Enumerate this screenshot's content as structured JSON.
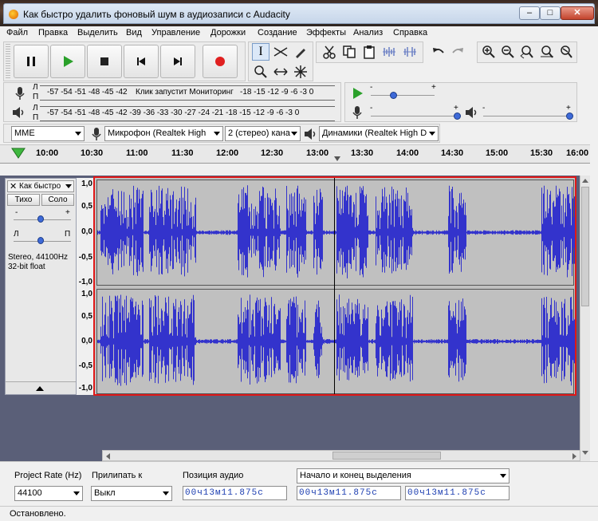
{
  "window": {
    "title": "Как быстро удалить фоновый шум в аудиозаписи с Audacity"
  },
  "menu": [
    "Файл",
    "Правка",
    "Выделить",
    "Вид",
    "Управление",
    "Дорожки",
    "Создание",
    "Эффекты",
    "Анализ",
    "Справка"
  ],
  "meters": {
    "record_channel_letters": [
      "Л",
      "П"
    ],
    "record_scale": "-57 -54 -51 -48 -45 -42",
    "record_prompt": "Клик запустит Мониторинг",
    "record_scale_tail": "-18 -15 -12 -9 -6 -3 0",
    "play_channel_letters": [
      "Л",
      "П"
    ],
    "play_scale": "-57 -54 -51 -48 -45 -42 -39 -36 -33 -30 -27 -24 -21 -18 -15 -12 -9 -6 -3 0"
  },
  "mixer": {
    "minus": "-",
    "plus": "+",
    "playback_volume": 0.3,
    "record_volume": 1.0,
    "playback_output_volume": 1.0
  },
  "device": {
    "host": "MME",
    "input": "Микрофон (Realtek High",
    "channels": "2 (стерео) кана",
    "output": "Динамики (Realtek High D"
  },
  "timeline": {
    "ticks": [
      "10:00",
      "10:30",
      "11:00",
      "11:30",
      "12:00",
      "12:30",
      "13:00",
      "13:30",
      "14:00",
      "14:30",
      "15:00",
      "15:30",
      "16:00"
    ]
  },
  "track": {
    "name": "Как быстро",
    "mute": "Тихо",
    "solo": "Соло",
    "gain_minus": "-",
    "gain_plus": "+",
    "pan_left": "Л",
    "pan_right": "П",
    "info_line1": "Stereo, 44100Hz",
    "info_line2": "32-bit float",
    "scale": [
      "1,0",
      "0,5",
      "0,0",
      "-0,5",
      "-1,0"
    ]
  },
  "bottom": {
    "rate_label": "Project Rate (Hz)",
    "rate_value": "44100",
    "snap_label": "Прилипать к",
    "snap_value": "Выкл",
    "pos_label": "Позиция аудио",
    "pos_value": "00ч13м11.875с",
    "sel_label": "Начало и конец выделения",
    "sel_start": "00ч13м11.875с",
    "sel_end": "00ч13м11.875с"
  },
  "status": "Остановлено.",
  "colors": {
    "waveform": "#3333cc",
    "selection_border": "#e01818",
    "record": "#e02020",
    "play": "#2aa02a"
  }
}
